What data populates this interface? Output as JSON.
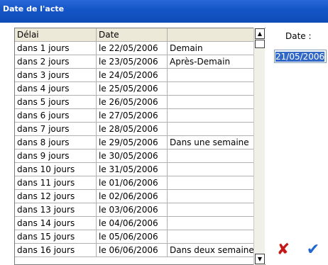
{
  "window": {
    "title": "Date de l'acte"
  },
  "table": {
    "headers": [
      "Délai",
      "Date",
      ""
    ],
    "rows": [
      [
        "dans 1 jours",
        "le 22/05/2006",
        "Demain"
      ],
      [
        "dans 2 jours",
        "le 23/05/2006",
        "Après-Demain"
      ],
      [
        "dans 3 jours",
        "le 24/05/2006",
        ""
      ],
      [
        "dans 4 jours",
        "le 25/05/2006",
        ""
      ],
      [
        "dans 5 jours",
        "le 26/05/2006",
        ""
      ],
      [
        "dans 6 jours",
        "le 27/05/2006",
        ""
      ],
      [
        "dans 7 jours",
        "le 28/05/2006",
        ""
      ],
      [
        "dans 8 jours",
        "le 29/05/2006",
        "Dans une semaine"
      ],
      [
        "dans 9 jours",
        "le 30/05/2006",
        ""
      ],
      [
        "dans 10 jours",
        "le 31/05/2006",
        ""
      ],
      [
        "dans 11 jours",
        "le 01/06/2006",
        ""
      ],
      [
        "dans 12 jours",
        "le 02/06/2006",
        ""
      ],
      [
        "dans 13 jours",
        "le 03/06/2006",
        ""
      ],
      [
        "dans 14 jours",
        "le 04/06/2006",
        ""
      ],
      [
        "dans 15 jours",
        "le 05/06/2006",
        ""
      ],
      [
        "dans 16 jours",
        "le 06/06/2006",
        "Dans deux semaine"
      ]
    ]
  },
  "date_panel": {
    "label": "Date :",
    "value": "21/05/2006"
  },
  "icons": {
    "cancel": "red-x-icon",
    "ok": "blue-checkmark-icon",
    "scroll_up": "arrow-up-icon",
    "scroll_down": "arrow-down-icon"
  },
  "colors": {
    "title_bar": "#1456c8",
    "selection": "#3167c6",
    "cancel": "#c41818",
    "ok": "#2266d0"
  }
}
